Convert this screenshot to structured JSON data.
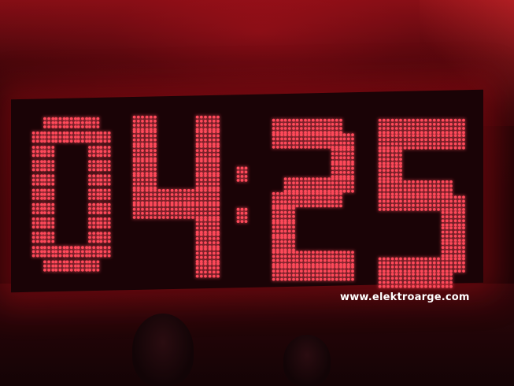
{
  "clock": {
    "time": "04:25",
    "led_color": "#ff4a5a"
  },
  "watermark": {
    "text": "www.elektroarge.com"
  }
}
